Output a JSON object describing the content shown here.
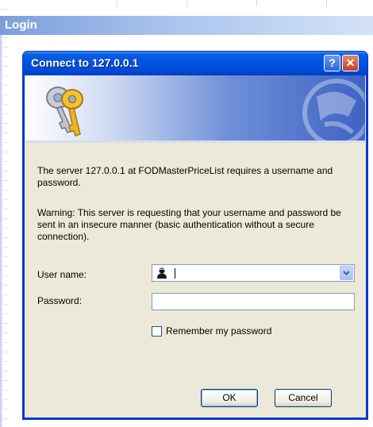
{
  "background_window": {
    "title": "Login"
  },
  "dialog": {
    "title": "Connect to 127.0.0.1",
    "help_button": "?",
    "close_button": "✕",
    "message": "The server 127.0.0.1 at FODMasterPriceList requires a username and password.",
    "warning": "Warning: This server is requesting that your username and password be sent in an insecure manner (basic authentication without a secure connection).",
    "fields": {
      "username_label": "User name:",
      "username_value": "",
      "password_label": "Password:",
      "password_value": ""
    },
    "remember_label": "Remember my password",
    "remember_checked": false,
    "ok_label": "OK",
    "cancel_label": "Cancel"
  },
  "colors": {
    "titlebar": "#0054e3",
    "dialog_bg": "#ece9d8",
    "input_border": "#7f9db9"
  },
  "icons": [
    "keys-icon",
    "globe-icon",
    "user-icon",
    "help-icon",
    "close-icon",
    "chevron-down-icon"
  ]
}
